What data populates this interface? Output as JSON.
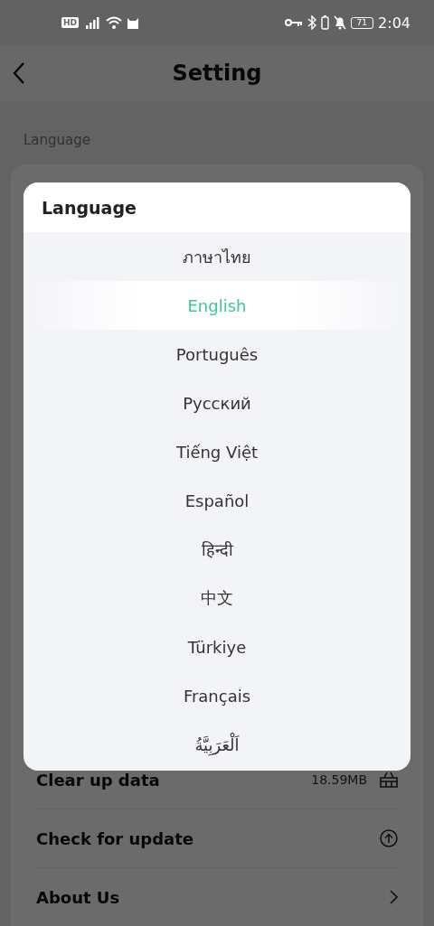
{
  "status_bar": {
    "network_badge": "HD",
    "battery_level_text": "71",
    "time": "2:04"
  },
  "header": {
    "title": "Setting"
  },
  "section_label": "Language",
  "settings_rows": [
    {
      "label": "Clear up data",
      "value": "18.59MB",
      "kind": "clear"
    },
    {
      "label": "Check for update",
      "kind": "update"
    },
    {
      "label": "About Us",
      "kind": "link"
    }
  ],
  "dialog": {
    "title": "Language",
    "options": [
      {
        "label": "ภาษาไทย",
        "selected": false
      },
      {
        "label": "English",
        "selected": true
      },
      {
        "label": "Português",
        "selected": false
      },
      {
        "label": "Русский",
        "selected": false
      },
      {
        "label": "Tiếng Việt",
        "selected": false
      },
      {
        "label": "Español",
        "selected": false
      },
      {
        "label": "हिन्दी",
        "selected": false
      },
      {
        "label": "中文",
        "selected": false
      },
      {
        "label": "Türkiye",
        "selected": false
      },
      {
        "label": "Français",
        "selected": false
      },
      {
        "label": "اَلْعَرَبِيَّةُ",
        "selected": false
      }
    ]
  }
}
